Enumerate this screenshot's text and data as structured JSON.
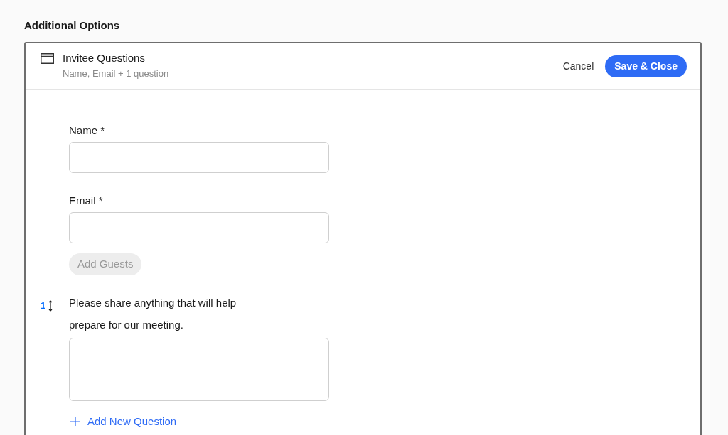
{
  "section_title": "Additional Options",
  "panel": {
    "title": "Invitee Questions",
    "subtitle": "Name, Email + 1 question",
    "cancel": "Cancel",
    "save": "Save & Close"
  },
  "fields": [
    {
      "kind": "input",
      "label": "Name *"
    },
    {
      "kind": "input",
      "label": "Email *"
    },
    {
      "kind": "pill",
      "label": "Add Guests",
      "disabled": true
    },
    {
      "kind": "question",
      "number": "1",
      "label": "Please share anything that will help prepare for our meeting."
    }
  ],
  "add_question": "Add New Question"
}
